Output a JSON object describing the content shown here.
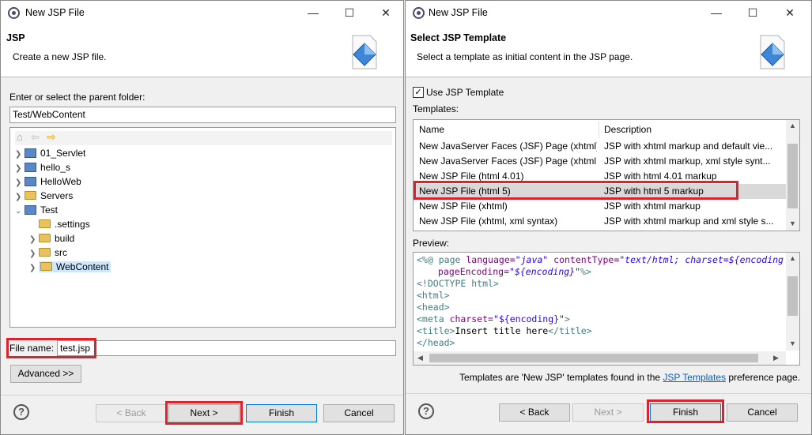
{
  "window1": {
    "title": "New JSP File",
    "header_title": "JSP",
    "header_desc": "Create a new JSP file.",
    "folder_label": "Enter or select the parent folder:",
    "folder_value": "Test/WebContent",
    "tree": [
      {
        "label": "01_Servlet"
      },
      {
        "label": "hello_s"
      },
      {
        "label": "HelloWeb"
      },
      {
        "label": "Servers"
      },
      {
        "label": "Test"
      },
      {
        "label": ".settings"
      },
      {
        "label": "build"
      },
      {
        "label": "src"
      },
      {
        "label": "WebContent"
      }
    ],
    "file_name_label": "File name:",
    "file_name_value": "test.jsp",
    "advanced_label": "Advanced >>",
    "back_label": "< Back",
    "next_label": "Next >",
    "finish_label": "Finish",
    "cancel_label": "Cancel"
  },
  "window2": {
    "title": "New JSP File",
    "header_title": "Select JSP Template",
    "header_desc": "Select a template as initial content in the JSP page.",
    "use_template_label": "Use JSP Template",
    "use_template_checked": true,
    "templates_label": "Templates:",
    "columns": [
      "Name",
      "Description"
    ],
    "rows": [
      {
        "name": "New JavaServer Faces (JSF) Page (xhtml)",
        "desc": "JSP with xhtml markup and default vie..."
      },
      {
        "name": "New JavaServer Faces (JSF) Page (xhtml...",
        "desc": "JSP with xhtml markup, xml style synt..."
      },
      {
        "name": "New JSP File (html 4.01)",
        "desc": "JSP with html 4.01 markup"
      },
      {
        "name": "New JSP File (html 5)",
        "desc": "JSP with html 5 markup"
      },
      {
        "name": "New JSP File (xhtml)",
        "desc": "JSP with xhtml markup"
      },
      {
        "name": "New JSP File (xhtml, xml syntax)",
        "desc": "JSP with xhtml markup and xml style s..."
      }
    ],
    "preview_label": "Preview:",
    "preview": {
      "l1_open": "<%@",
      "l1_page": "page",
      "l1_lang_attr": "language=",
      "l1_lang_val": "\"java\"",
      "l1_ct_attr": "contentType=",
      "l1_ct_val": "\"text/html; charset=",
      "l1_enc": "${encoding",
      "l2_pe_attr": "pageEncoding=",
      "l2_pe_val": "\"${encoding}\"",
      "l2_close": "%>",
      "l3": "<!DOCTYPE html>",
      "l4": "<html>",
      "l5": "<head>",
      "l6_tag": "<meta",
      "l6_attr": "charset=",
      "l6_val": "\"${encoding}\"",
      "l6_close": ">",
      "l7_open": "<title>",
      "l7_text": "Insert title here",
      "l7_close": "</title>",
      "l8": "</head>"
    },
    "footer_prefix": "Templates are 'New JSP' templates found in the ",
    "footer_link": "JSP Templates",
    "footer_suffix": " preference page.",
    "back_label": "< Back",
    "next_label": "Next >",
    "finish_label": "Finish",
    "cancel_label": "Cancel"
  }
}
